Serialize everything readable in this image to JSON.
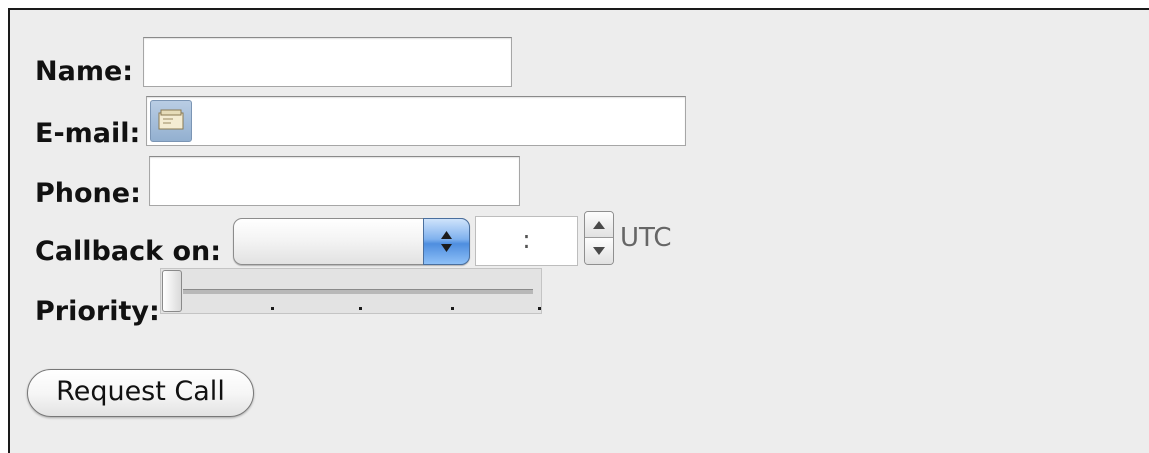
{
  "form": {
    "name": {
      "label": "Name:",
      "value": ""
    },
    "email": {
      "label": "E-mail:",
      "value": "",
      "icon": "address-card-icon"
    },
    "phone": {
      "label": "Phone:",
      "value": ""
    },
    "callback": {
      "label": "Callback on:",
      "selected_day": "",
      "time_value": ":",
      "timezone": "UTC"
    },
    "priority": {
      "label": "Priority:",
      "level": 0,
      "ticks": 5
    },
    "submit_label": "Request Call"
  },
  "colors": {
    "panel_background": "#ededed",
    "select_arrow_accent": "#4f8edf"
  }
}
